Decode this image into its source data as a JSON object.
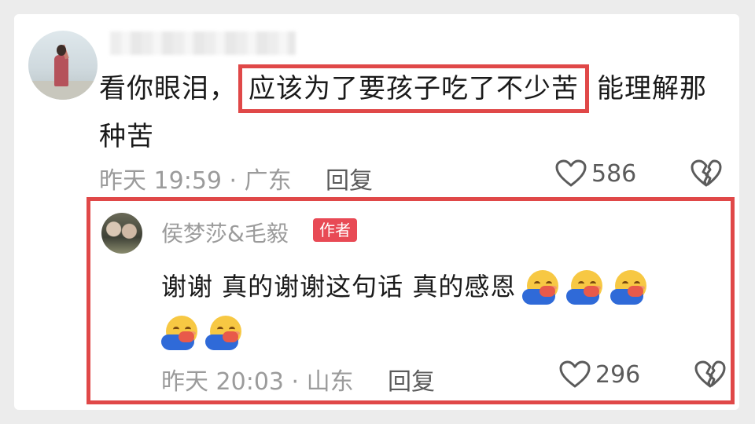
{
  "comment": {
    "text_before": "看你眼泪，",
    "highlighted": "应该为了要孩子吃了不少苦",
    "text_after": "能理解那种苦",
    "time_location": "昨天 19:59 · 广东",
    "reply_label": "回复",
    "like_count": "586",
    "icons": [
      "heart-outline-icon",
      "broken-heart-icon"
    ]
  },
  "reply": {
    "author": "侯梦莎&毛毅",
    "badge": "作者",
    "text": "谢谢 真的谢谢这句话 真的感恩",
    "emoji_count_inline": 3,
    "emoji_count_second_line": 2,
    "emoji_name": "hugging-face-emoji",
    "time_location": "昨天 20:03 · 山东",
    "reply_label": "回复",
    "like_count": "296"
  },
  "colors": {
    "highlight_border": "#e04848",
    "author_badge": "#e84a55",
    "meta_gray": "#9b9b9b",
    "text": "#1a1a1a"
  }
}
